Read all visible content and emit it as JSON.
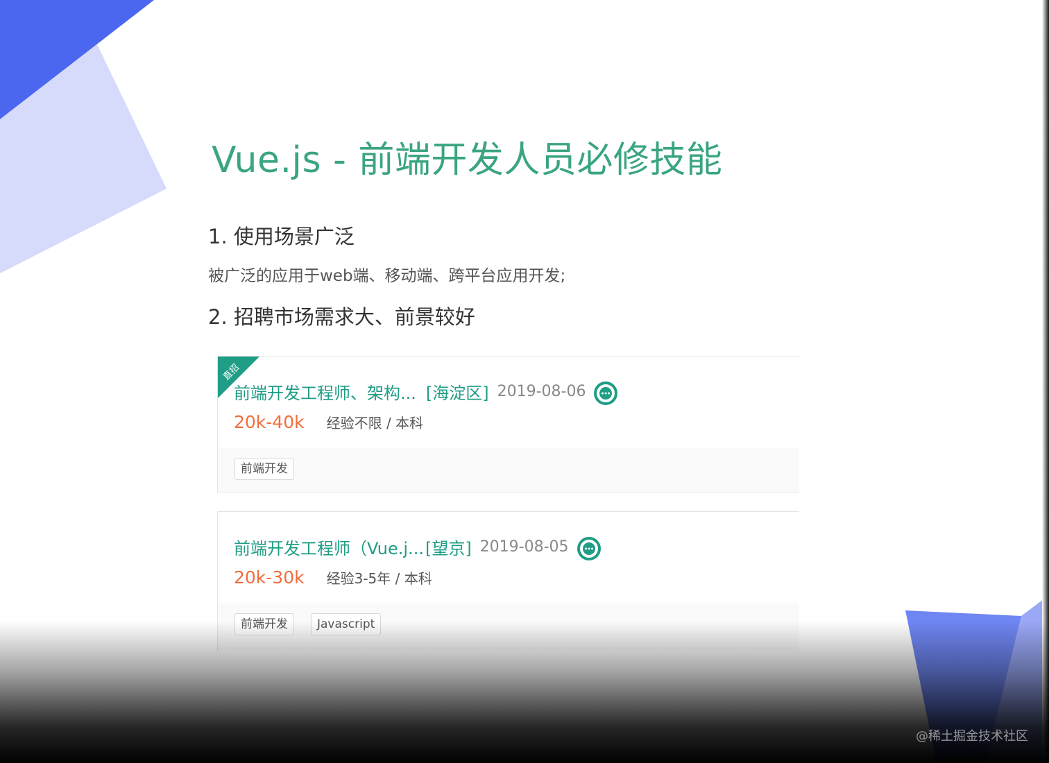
{
  "slide": {
    "title": "Vue.js - 前端开发人员必修技能",
    "point1": "1. 使用场景广泛",
    "point1_desc": "被广泛的应用于web端、移动端、跨平台应用开发;",
    "point2": "2. 招聘市场需求大、前景较好"
  },
  "jobs": [
    {
      "badge": "直招",
      "title": "前端开发工程师、架构...",
      "location": "[海淀区]",
      "date": "2019-08-06",
      "salary": "20k-40k",
      "requirement": "经验不限 / 本科",
      "tags": [
        "前端开发"
      ]
    },
    {
      "title": "前端开发工程师（Vue.j...",
      "location": "[望京]",
      "date": "2019-08-05",
      "salary": "20k-30k",
      "requirement": "经验3-5年 / 本科",
      "tags": [
        "前端开发",
        "Javascript"
      ]
    }
  ],
  "watermark": "@稀土掘金技术社区",
  "colors": {
    "title_green": "#3aa57f",
    "job_title_teal": "#1f9d85",
    "salary_orange": "#f26d3d",
    "deco_blue": "#4b67f0",
    "deco_lavender": "#d6dafb"
  },
  "icons": [
    "chat-bubble-icon"
  ]
}
